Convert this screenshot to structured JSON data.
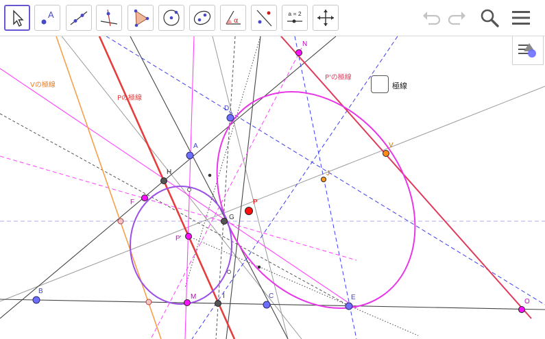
{
  "toolbar": {
    "tools": [
      {
        "name": "move-tool",
        "icon": "pointer-arrow-icon",
        "selected": true
      },
      {
        "name": "point-tool",
        "icon": "point-a-icon",
        "label": "A"
      },
      {
        "name": "line-tool",
        "icon": "line-icon"
      },
      {
        "name": "perpendicular-line-tool",
        "icon": "perpendicular-line-icon"
      },
      {
        "name": "polygon-tool",
        "icon": "polygon-icon"
      },
      {
        "name": "circle-tool",
        "icon": "circle-with-center-icon"
      },
      {
        "name": "conic-tool",
        "icon": "ellipse-icon"
      },
      {
        "name": "angle-tool",
        "icon": "angle-icon",
        "label": "α"
      },
      {
        "name": "reflect-tool",
        "icon": "reflect-icon"
      },
      {
        "name": "slider-tool",
        "icon": "slider-icon",
        "label": "a = 2"
      },
      {
        "name": "move-graphics-tool",
        "icon": "move-graphics-icon"
      }
    ],
    "undo_icon": "undo-icon",
    "redo_icon": "redo-icon",
    "search_icon": "search-icon",
    "menu_icon": "hamburger-menu-icon"
  },
  "graphics": {
    "checkbox_label": "極線",
    "checkbox_checked": false,
    "line_labels": {
      "v_polar": "Vの極線",
      "p_polar": "Pの極線",
      "p_prime_polar": "P'の極線"
    },
    "points": {
      "A": "A",
      "B": "B",
      "C": "C",
      "D": "D",
      "E": "E",
      "F": "F",
      "G": "G",
      "H": "H",
      "I": "I",
      "J": "J",
      "M": "M",
      "N": "N",
      "O": "O",
      "P": "P",
      "P_prime": "P'",
      "V": "V"
    }
  },
  "colors": {
    "accent": "#6557d2",
    "point_blue": "#6f6fff",
    "point_red": "#ff0000",
    "point_magenta": "#ff00ff",
    "ellipse_magenta": "#e835e8",
    "circle_purple": "#9b4fe6",
    "polar_red": "#e63c3c",
    "polar_orange": "#f5a04a",
    "dashed_blue": "#3d3df0",
    "gray_line": "#9a9a9a"
  }
}
